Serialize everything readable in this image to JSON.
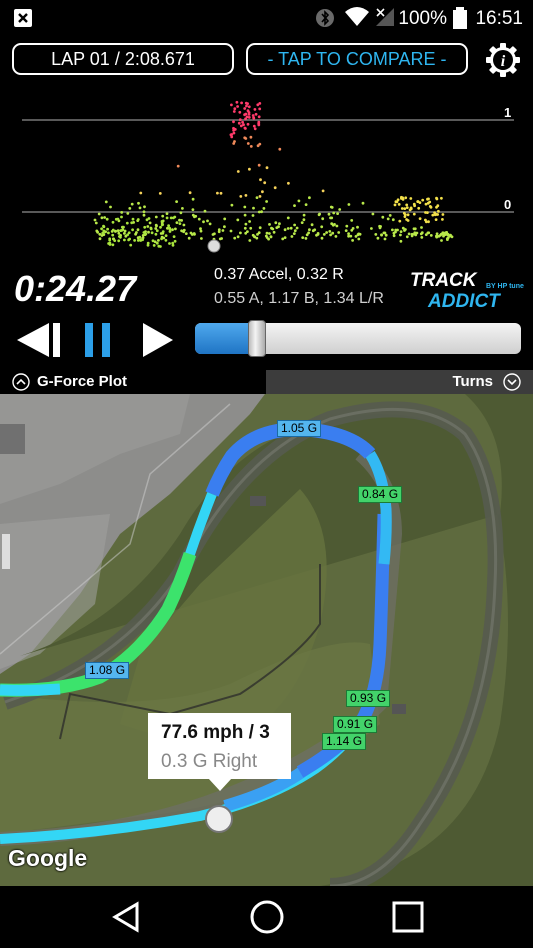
{
  "status_bar": {
    "battery": "100%",
    "time": "16:51"
  },
  "header": {
    "lap_label": "LAP 01 / 2:08.671",
    "compare_label": "- TAP TO COMPARE -",
    "info_icon": "info-gear-icon"
  },
  "gforce_plot": {
    "tick_top": "1",
    "tick_bottom": "0"
  },
  "playback": {
    "timer": "0:24.27",
    "accel_line1": "0.37 Accel, 0.32 R",
    "accel_line2": "0.55 A, 1.17 B, 1.34 L/R",
    "progress": 0.19
  },
  "logo": {
    "text": "TRACK ADDICT",
    "by_text": "BY HP tuners"
  },
  "tabs": {
    "left_label": "G-Force Plot",
    "right_label": "Turns"
  },
  "map": {
    "labels": [
      "1.05 G",
      "0.84 G",
      "1.08 G",
      "0.93 G",
      "0.91 G",
      "1.14 G"
    ],
    "callout_line1": "77.6 mph / 3",
    "callout_line2": "0.3 G Right",
    "watermark": "Google"
  },
  "colors": {
    "accent": "#2fb6f0",
    "track_green": "#3ce36c",
    "track_blue": "#3a7ef0",
    "track_cyan": "#33d6f5"
  }
}
